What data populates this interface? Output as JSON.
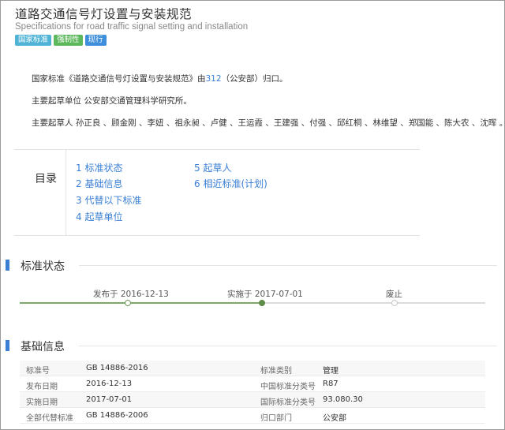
{
  "header": {
    "title": "道路交通信号灯设置与安装规范",
    "subtitle": "Specifications for road traffic signal setting and installation",
    "badges": [
      "国家标准",
      "强制性",
      "现行"
    ]
  },
  "intro": {
    "line1_prefix": "国家标准《道路交通信号灯设置与安装规范》由",
    "line1_link": "312",
    "line1_suffix": "（公安部）归口。",
    "line2": "主要起草单位 公安部交通管理科学研究所。",
    "line3": "主要起草人 孙正良 、顾金刚 、李妞 、祖永昶 、卢健 、王运霞 、王建强 、付强 、邱红桐 、林维望 、郑国能 、陈大农 、沈晖 。"
  },
  "toc": {
    "title": "目录",
    "items": [
      "1 标准状态",
      "2 基础信息",
      "3 代替以下标准",
      "4 起草单位",
      "5 起草人",
      "6 相近标准(计划)"
    ]
  },
  "status_section": {
    "title": "标准状态",
    "timeline": [
      {
        "label": "发布于 2016-12-13",
        "state": "done"
      },
      {
        "label": "实施于 2017-07-01",
        "state": "current"
      },
      {
        "label": "废止",
        "state": "pending"
      }
    ]
  },
  "basic_section": {
    "title": "基础信息",
    "rows": [
      {
        "l1": "标准号",
        "v1": "GB 14886-2016",
        "l2": "标准类别",
        "v2": "管理"
      },
      {
        "l1": "发布日期",
        "v1": "2016-12-13",
        "l2": "中国标准分类号",
        "v2": "R87"
      },
      {
        "l1": "实施日期",
        "v1": "2017-07-01",
        "l2": "国际标准分类号",
        "v2": "93.080.30"
      },
      {
        "l1": "全部代替标准",
        "v1": "GB 14886-2006",
        "l2": "归口部门",
        "v2": "公安部"
      }
    ]
  },
  "colors": {
    "link": "#3a7fd5",
    "section_bar": "#3a7fd5",
    "timeline_done": "#5d8c4b"
  }
}
